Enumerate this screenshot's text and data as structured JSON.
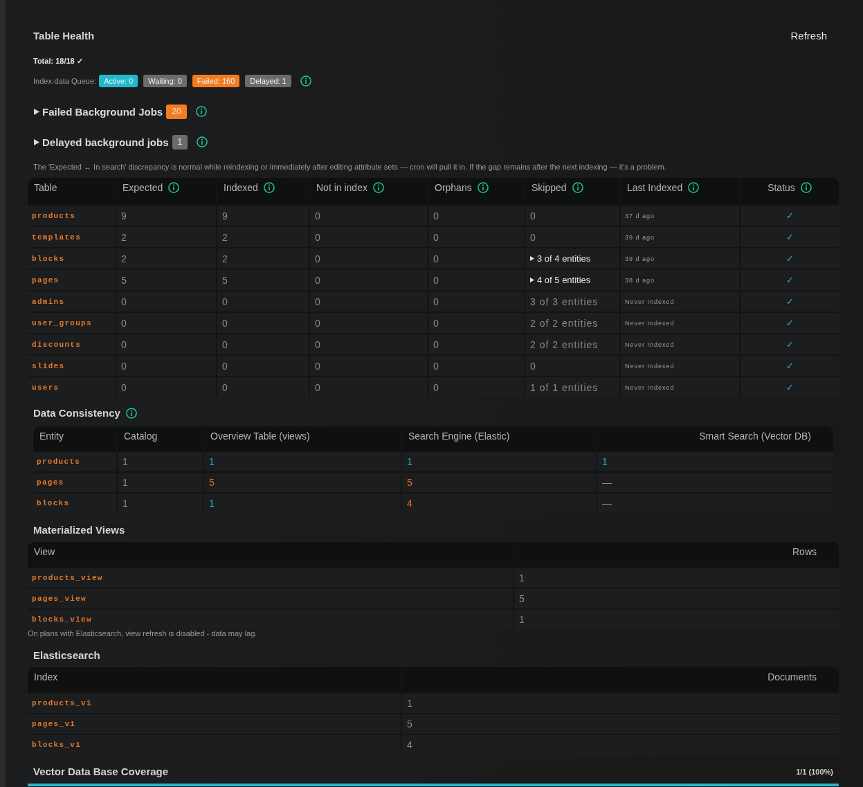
{
  "table_health": {
    "title": "Table Health",
    "refresh": "Refresh",
    "total": "Total: 18/18 ✓",
    "queue": {
      "label": "Index-data Queue:",
      "info": true,
      "badges": [
        {
          "text": "Active: 0",
          "color": "#22b8cf"
        },
        {
          "text": "Waiting: 0",
          "color": "#6b6b6b"
        },
        {
          "text": "Failed: 160",
          "color": "#f47c20"
        },
        {
          "text": "Delayed: 1",
          "color": "#6b6b6b"
        }
      ]
    },
    "jobs": [
      {
        "title": "Failed Background Jobs",
        "count": "20",
        "color": "#f47c20",
        "expanded": false,
        "info": true
      },
      {
        "title": "Delayed background jobs",
        "count": "1",
        "color": "#6b6b6b",
        "expanded": false,
        "info": true
      }
    ],
    "note": "The 'Expected ↔ In search' discrepancy is normal while reindexing or immediately after editing attribute sets — cron will pull it in. If the gap remains after the next indexing — it's a problem.",
    "table": {
      "columns": [
        {
          "label": "Table",
          "info": false
        },
        {
          "label": "Expected",
          "info": true
        },
        {
          "label": "Indexed",
          "info": true
        },
        {
          "label": "Not in index",
          "info": true
        },
        {
          "label": "Orphans",
          "info": true
        },
        {
          "label": "Skipped",
          "info": true
        },
        {
          "label": "Last Indexed",
          "info": true
        },
        {
          "label": "Status",
          "info": true
        }
      ],
      "rows": [
        {
          "name": "products",
          "expected": "9",
          "indexed": "9",
          "not_in_index": "0",
          "orphans": "0",
          "skipped": {
            "text": "0",
            "expandable": false
          },
          "last_indexed": "37 d ago",
          "status": "✓"
        },
        {
          "name": "templates",
          "expected": "2",
          "indexed": "2",
          "not_in_index": "0",
          "orphans": "0",
          "skipped": {
            "text": "0",
            "expandable": false
          },
          "last_indexed": "39 d ago",
          "status": "✓"
        },
        {
          "name": "blocks",
          "expected": "2",
          "indexed": "2",
          "not_in_index": "0",
          "orphans": "0",
          "skipped": {
            "text": "3 of 4 entities",
            "expandable": true
          },
          "last_indexed": "39 d ago",
          "status": "✓"
        },
        {
          "name": "pages",
          "expected": "5",
          "indexed": "5",
          "not_in_index": "0",
          "orphans": "0",
          "skipped": {
            "text": "4 of 5 entities",
            "expandable": true
          },
          "last_indexed": "38 d ago",
          "status": "✓"
        },
        {
          "name": "admins",
          "expected": "0",
          "indexed": "0",
          "not_in_index": "0",
          "orphans": "0",
          "skipped": {
            "text": "3 of 3 entities",
            "expandable": false
          },
          "last_indexed": "Never Indexed",
          "status": "✓"
        },
        {
          "name": "user_groups",
          "expected": "0",
          "indexed": "0",
          "not_in_index": "0",
          "orphans": "0",
          "skipped": {
            "text": "2 of 2 entities",
            "expandable": false
          },
          "last_indexed": "Never Indexed",
          "status": "✓"
        },
        {
          "name": "discounts",
          "expected": "0",
          "indexed": "0",
          "not_in_index": "0",
          "orphans": "0",
          "skipped": {
            "text": "2 of 2 entities",
            "expandable": false
          },
          "last_indexed": "Never Indexed",
          "status": "✓"
        },
        {
          "name": "slides",
          "expected": "0",
          "indexed": "0",
          "not_in_index": "0",
          "orphans": "0",
          "skipped": {
            "text": "0",
            "expandable": false
          },
          "last_indexed": "Never Indexed",
          "status": "✓"
        },
        {
          "name": "users",
          "expected": "0",
          "indexed": "0",
          "not_in_index": "0",
          "orphans": "0",
          "skipped": {
            "text": "1 of 1 entities",
            "expandable": false
          },
          "last_indexed": "Never Indexed",
          "status": "✓"
        }
      ]
    }
  },
  "data_consistency": {
    "title": "Data Consistency",
    "info": true,
    "columns": [
      "Entity",
      "Catalog",
      "Overview Table (views)",
      "Search Engine (Elastic)",
      "Smart Search (Vector DB)"
    ],
    "rows": [
      {
        "entity": "products",
        "values": [
          {
            "text": "1",
            "color": "#8b8b8b"
          },
          {
            "text": "1",
            "color": "#1fb3c8"
          },
          {
            "text": "1",
            "color": "#1fb3c8"
          },
          {
            "text": "1",
            "color": "#1fb3c8"
          }
        ]
      },
      {
        "entity": "pages",
        "values": [
          {
            "text": "1",
            "color": "#8b8b8b"
          },
          {
            "text": "5",
            "color": "#f06a1e"
          },
          {
            "text": "5",
            "color": "#f06a1e"
          },
          {
            "text": "—",
            "color": "#8b8b8b"
          }
        ]
      },
      {
        "entity": "blocks",
        "values": [
          {
            "text": "1",
            "color": "#8b8b8b"
          },
          {
            "text": "1",
            "color": "#1fb3c8"
          },
          {
            "text": "4",
            "color": "#f06a1e"
          },
          {
            "text": "—",
            "color": "#8b8b8b"
          }
        ]
      }
    ]
  },
  "materialized_views": {
    "title": "Materialized Views",
    "columns": [
      "View",
      "Rows"
    ],
    "rows": [
      {
        "name": "products_view",
        "rows": "1"
      },
      {
        "name": "pages_view",
        "rows": "5"
      },
      {
        "name": "blocks_view",
        "rows": "1"
      }
    ],
    "note": "On plans with Elasticsearch, view refresh is disabled - data may lag."
  },
  "elasticsearch": {
    "title": "Elasticsearch",
    "columns": [
      "Index",
      "Documents"
    ],
    "rows": [
      {
        "name": "products_v1",
        "documents": "1"
      },
      {
        "name": "pages_v1",
        "documents": "5"
      },
      {
        "name": "blocks_v1",
        "documents": "4"
      }
    ]
  },
  "vector_coverage": {
    "title": "Vector Data Base Coverage",
    "reading": "1/1 (100%)",
    "level": 1
  }
}
